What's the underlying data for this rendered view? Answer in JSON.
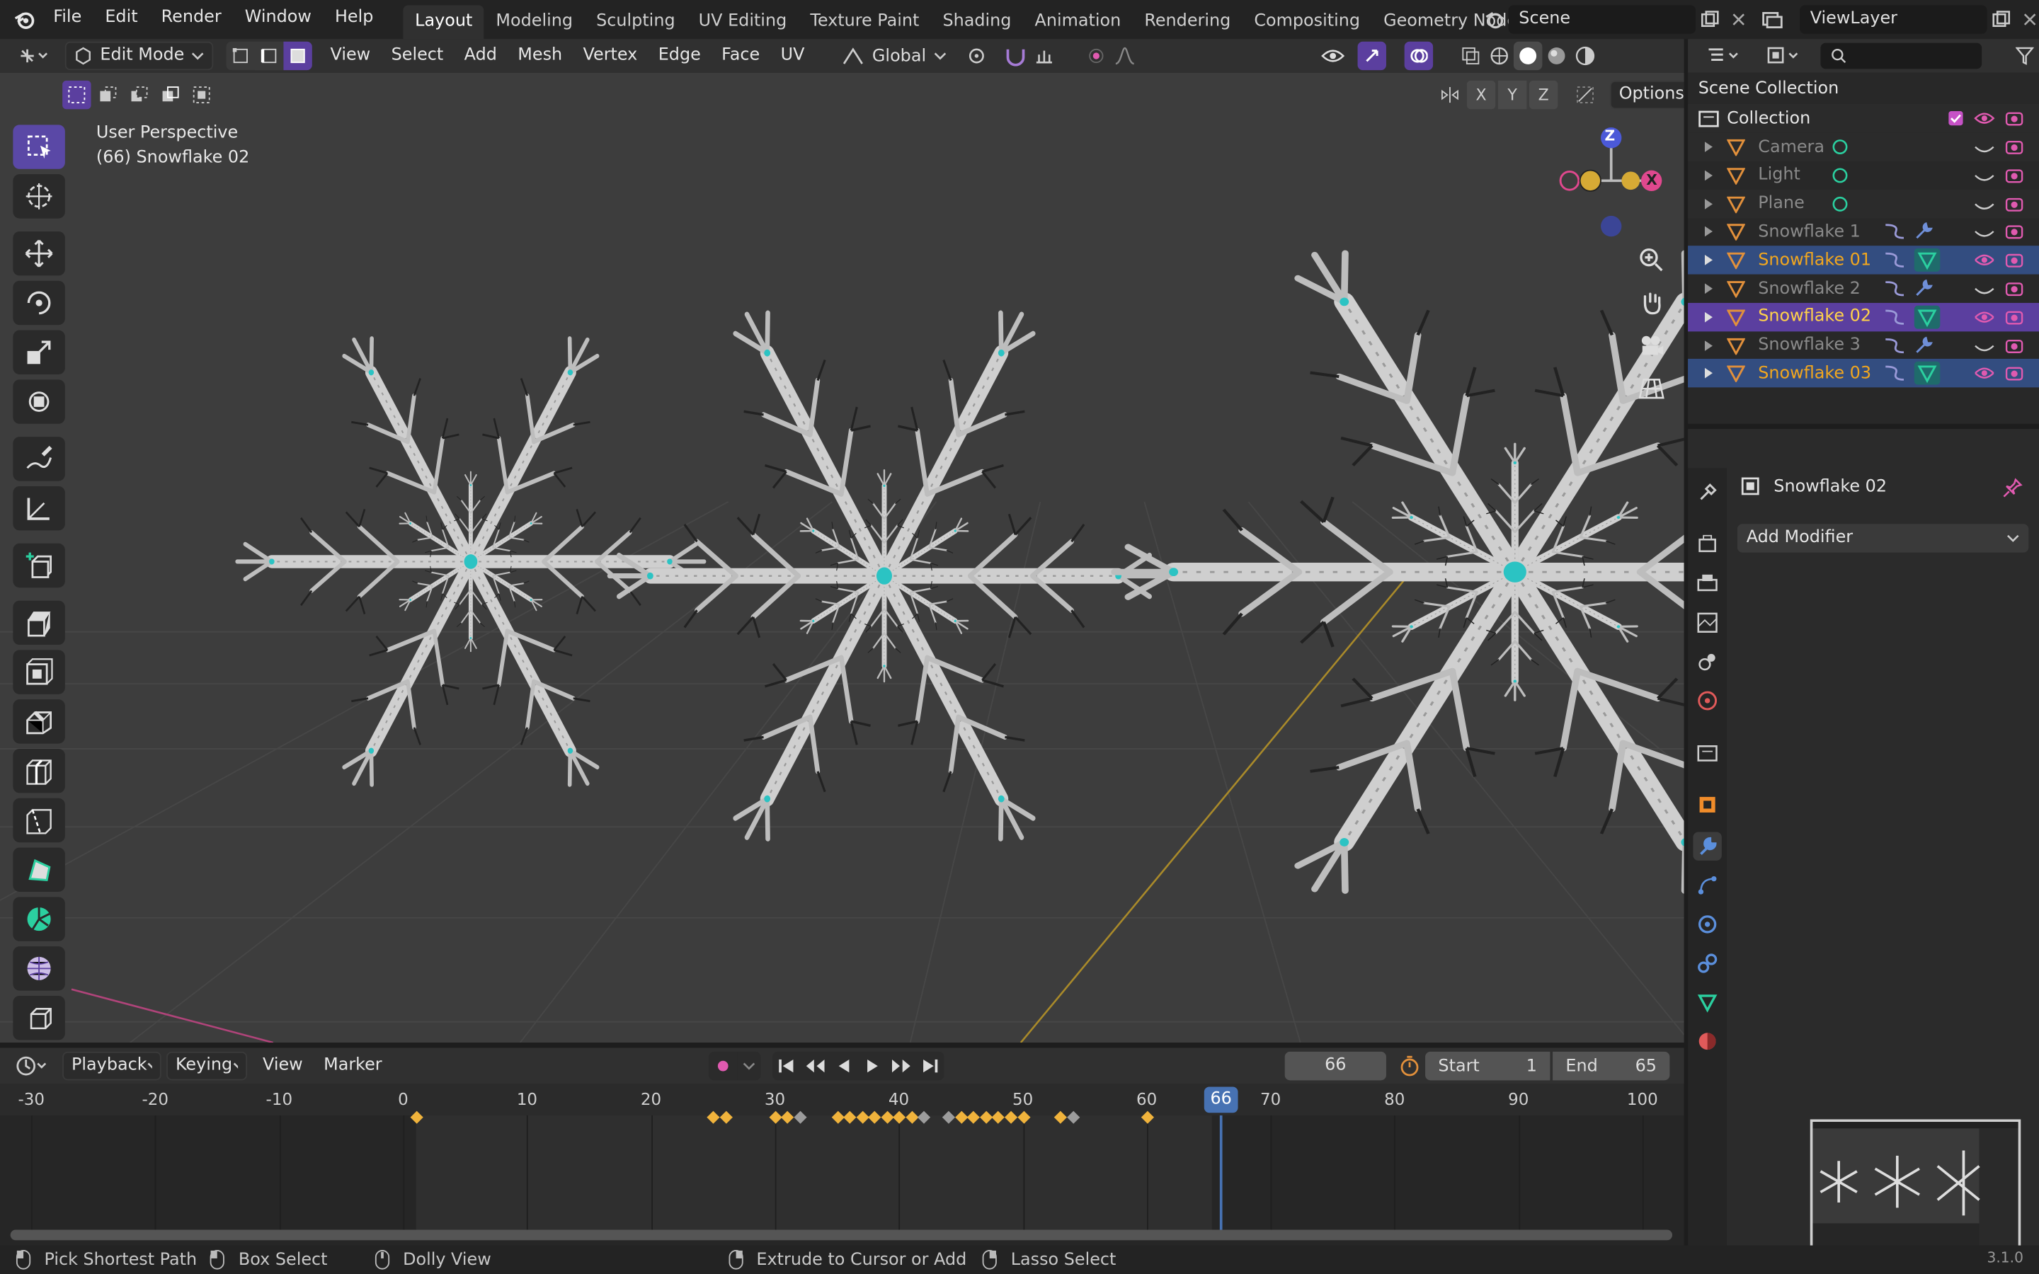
{
  "app": {
    "menus": [
      "File",
      "Edit",
      "Render",
      "Window",
      "Help"
    ],
    "workspaces": [
      "Layout",
      "Modeling",
      "Sculpting",
      "UV Editing",
      "Texture Paint",
      "Shading",
      "Animation",
      "Rendering",
      "Compositing",
      "Geometry Nodes"
    ],
    "active_workspace": "Layout",
    "scene": "Scene",
    "view_layer": "ViewLayer"
  },
  "viewport_header": {
    "mode": "Edit Mode",
    "menus": [
      "View",
      "Select",
      "Add",
      "Mesh",
      "Vertex",
      "Edge",
      "Face",
      "UV"
    ],
    "transform_orientation": "Global",
    "options": "Options",
    "axes": [
      "X",
      "Y",
      "Z"
    ]
  },
  "viewport": {
    "perspective_label": "User Perspective",
    "object_label": "(66) Snowflake 02",
    "gizmo_axes": {
      "z": "Z",
      "x": "X"
    }
  },
  "outliner": {
    "root": "Scene Collection",
    "collection": "Collection",
    "items": [
      {
        "name": "Camera",
        "color": "#8a8a8a",
        "icon": "camera-icon"
      },
      {
        "name": "Light",
        "color": "#8a8a8a",
        "icon": "light-icon"
      },
      {
        "name": "Plane",
        "color": "#8a8a8a",
        "icon": "mesh-icon"
      },
      {
        "name": "Snowflake 1",
        "color": "#8a8a8a",
        "icon": "mesh-icon"
      },
      {
        "name": "Snowflake 01",
        "color": "#f2a71e",
        "icon": "mesh-icon",
        "state": "selected"
      },
      {
        "name": "Snowflake 2",
        "color": "#8a8a8a",
        "icon": "mesh-icon"
      },
      {
        "name": "Snowflake 02",
        "color": "#ffd24a",
        "icon": "mesh-icon",
        "state": "active"
      },
      {
        "name": "Snowflake 3",
        "color": "#8a8a8a",
        "icon": "mesh-icon"
      },
      {
        "name": "Snowflake 03",
        "color": "#f2a71e",
        "icon": "mesh-icon",
        "state": "selected"
      }
    ]
  },
  "properties": {
    "object_name": "Snowflake 02",
    "add_modifier": "Add Modifier"
  },
  "timeline": {
    "menus": [
      "Playback",
      "Keying",
      "View",
      "Marker"
    ],
    "current_frame": "66",
    "start_label": "Start",
    "start_value": "1",
    "end_label": "End",
    "end_value": "65",
    "ruler": [
      "-30",
      "-20",
      "-10",
      "0",
      "10",
      "20",
      "30",
      "40",
      "50",
      "60",
      "70",
      "80",
      "90",
      "100"
    ]
  },
  "status_bar": {
    "items": [
      "Pick Shortest Path",
      "Box Select",
      "Dolly View",
      "Extrude to Cursor or Add",
      "Lasso Select"
    ],
    "version": "3.1.0"
  },
  "colors": {
    "accent_purple": "#5b3f9f",
    "selected_blue": "#334d80",
    "keyframe": "#f0b33c",
    "playhead": "#4772b3",
    "axis_x": "#e0488e",
    "axis_y": "#d6aa35",
    "axis_z": "#4b59d8"
  }
}
